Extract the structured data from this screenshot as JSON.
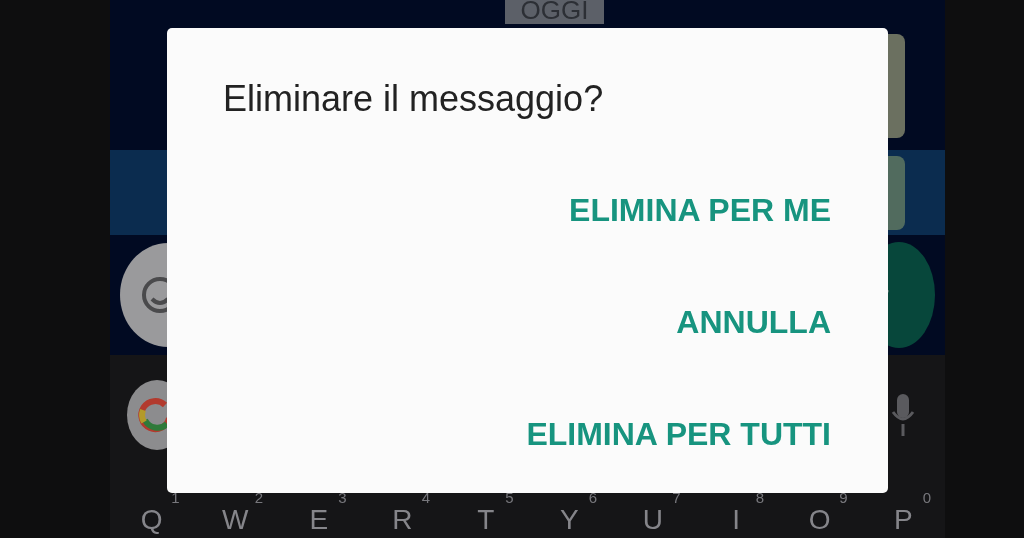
{
  "date_chip": "OGGI",
  "dialog": {
    "title": "Eliminare il messaggio?",
    "actions": [
      "ELIMINA PER ME",
      "ANNULLA",
      "ELIMINA PER TUTTI"
    ]
  },
  "keyboard": {
    "keys": [
      {
        "digit": "1",
        "letter": "Q"
      },
      {
        "digit": "2",
        "letter": "W"
      },
      {
        "digit": "3",
        "letter": "E"
      },
      {
        "digit": "4",
        "letter": "R"
      },
      {
        "digit": "5",
        "letter": "T"
      },
      {
        "digit": "6",
        "letter": "Y"
      },
      {
        "digit": "7",
        "letter": "U"
      },
      {
        "digit": "8",
        "letter": "I"
      },
      {
        "digit": "9",
        "letter": "O"
      },
      {
        "digit": "0",
        "letter": "P"
      }
    ]
  }
}
